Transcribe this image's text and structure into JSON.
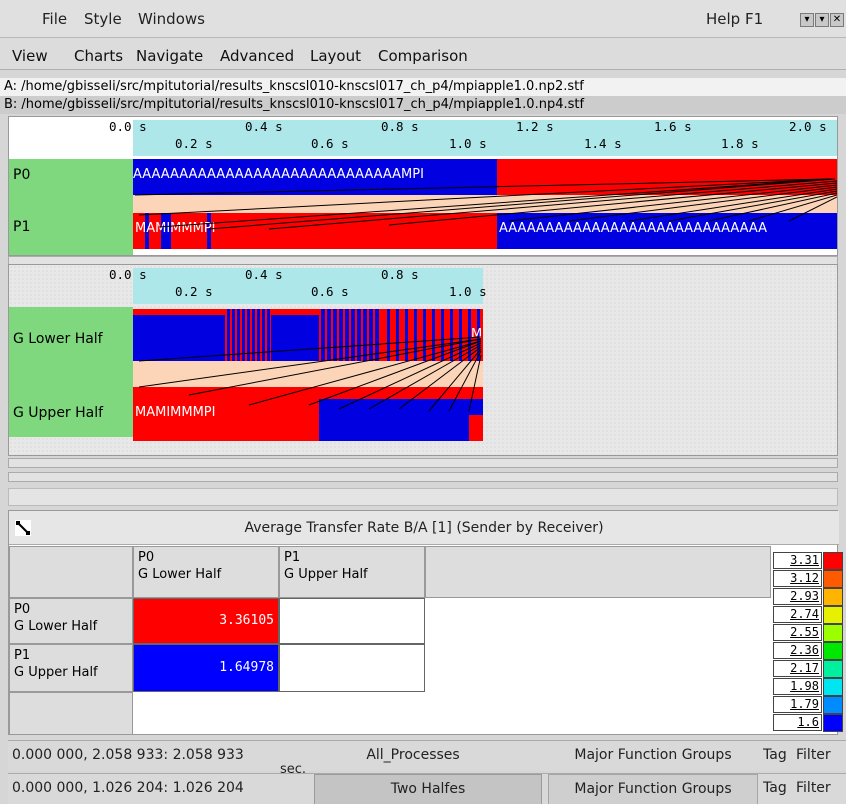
{
  "titlebar": {
    "menus": [
      "File",
      "Style",
      "Windows"
    ],
    "help": "Help F1",
    "controls": [
      "▾",
      "▾",
      "✕"
    ]
  },
  "menubar": {
    "items": [
      "View",
      "Charts",
      "Navigate",
      "Advanced",
      "Layout",
      "Comparison"
    ]
  },
  "files": {
    "a": "A: /home/gbisseli/src/mpitutorial/results_knscsl010-knscsl017_ch_p4/mpiapple1.0.np2.stf",
    "b": "B: /home/gbisseli/src/mpitutorial/results_knscsl010-knscsl017_ch_p4/mpiapple1.0.np4.stf"
  },
  "timeline_a": {
    "ticks_top": [
      "0.0 s",
      "0.4 s",
      "0.8 s",
      "1.2 s",
      "1.6 s",
      "2.0 s"
    ],
    "ticks_bottom": [
      "0.2 s",
      "0.6 s",
      "1.0 s",
      "1.4 s",
      "1.8 s"
    ],
    "rows": [
      {
        "label": "P0",
        "text": "AAAAAAAAAAAAAAAAAAAAAAAAAAAAAMPI"
      },
      {
        "label": "P1",
        "text": "MAMIMMMPI",
        "text2": "AAAAAAAAAAAAAAAAAAAAAAAAAAAAA"
      }
    ]
  },
  "timeline_b": {
    "ticks_top": [
      "0.0 s",
      "0.4 s",
      "0.8 s"
    ],
    "ticks_bottom": [
      "0.2 s",
      "0.6 s",
      "1.0 s"
    ],
    "rows": [
      {
        "label": "G Lower Half",
        "text": "M"
      },
      {
        "label": "G Upper Half",
        "text": "MAMIMMMPI"
      }
    ]
  },
  "stats": {
    "title": "Average Transfer Rate B/A [1] (Sender by Receiver)",
    "col_headers": [
      {
        "line1": "P0",
        "line2": "G Lower Half"
      },
      {
        "line1": "P1",
        "line2": "G Upper Half"
      }
    ],
    "row_headers": [
      {
        "line1": "P0",
        "line2": "G Lower Half"
      },
      {
        "line1": "P1",
        "line2": "G Upper Half"
      }
    ],
    "cells": [
      {
        "value": "3.36105",
        "color": "#ff0000"
      },
      {
        "value": "1.64978",
        "color": "#0000ff"
      }
    ],
    "legend": [
      {
        "value": "3.31",
        "color": "#ff0000"
      },
      {
        "value": "3.12",
        "color": "#ff5a00"
      },
      {
        "value": "2.93",
        "color": "#ffb400"
      },
      {
        "value": "2.74",
        "color": "#e6f000"
      },
      {
        "value": "2.55",
        "color": "#9cff00"
      },
      {
        "value": "2.36",
        "color": "#00e800"
      },
      {
        "value": "2.17",
        "color": "#00f0a0"
      },
      {
        "value": "1.98",
        "color": "#00e6f0"
      },
      {
        "value": "1.79",
        "color": "#008cff"
      },
      {
        "value": "1.6",
        "color": "#0000ff"
      }
    ]
  },
  "status": {
    "row1": {
      "range": "0.000 000, 2.058 933: 2.058 933",
      "process": "All_Processes",
      "groups": "Major Function Groups",
      "tag": "Tag",
      "filter": "Filter"
    },
    "row2": {
      "range": "0.000 000, 1.026 204: 1.026 204",
      "process": "Two Halfes",
      "groups": "Major Function Groups",
      "tag": "Tag",
      "filter": "Filter"
    },
    "unit": "sec."
  },
  "colors": {
    "mpi": "#ff0000",
    "app": "#0000e0",
    "label_bg": "#80d87e",
    "axis_bg": "#aee7ea",
    "msg_band": "#fcd5b8"
  }
}
